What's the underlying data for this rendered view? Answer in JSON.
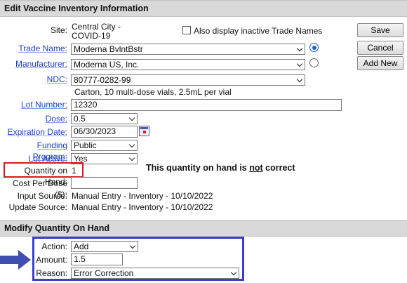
{
  "header": {
    "title": "Edit Vaccine Inventory Information"
  },
  "site": {
    "label": "Site:",
    "line1": "Central City -",
    "line2": "COVID-19"
  },
  "inactive": {
    "label": "Also display inactive Trade Names"
  },
  "buttons": {
    "save": "Save",
    "cancel": "Cancel",
    "add_new": "Add New"
  },
  "fields": {
    "trade_name": {
      "label": "Trade Name:",
      "value": "Moderna BvlntBstr"
    },
    "manufacturer": {
      "label": "Manufacturer:",
      "value": "Moderna US, Inc."
    },
    "ndc": {
      "label": "NDC:",
      "value": "80777-0282-99",
      "description": "Carton, 10 multi-dose vials, 2.5mL per vial"
    },
    "lot_number": {
      "label": "Lot Number:",
      "value": "12320"
    },
    "dose": {
      "label": "Dose:",
      "value": "0.5"
    },
    "expiration_date": {
      "label": "Expiration Date:",
      "value": "06/30/2023"
    },
    "funding_program": {
      "label": "Funding Program:",
      "value": "Public"
    },
    "lot_active": {
      "label": "Lot Active:",
      "value": "Yes"
    },
    "quantity_on_hand": {
      "label": "Quantity on Hand:",
      "value": "1"
    },
    "cost_per_dose": {
      "label": "Cost Per Dose ($):",
      "value": ""
    },
    "input_source": {
      "label": "Input Source:",
      "value": "Manual Entry - Inventory - 10/10/2022"
    },
    "update_source": {
      "label": "Update Source:",
      "value": "Manual Entry - Inventory - 10/10/2022"
    }
  },
  "annotation": {
    "pre": "This quantity on hand is ",
    "emph": "not",
    "post": " correct"
  },
  "modify": {
    "title": "Modify Quantity On Hand",
    "action": {
      "label": "Action:",
      "value": "Add"
    },
    "amount": {
      "label": "Amount:",
      "value": "1.5"
    },
    "reason": {
      "label": "Reason:",
      "value": "Error Correction"
    }
  },
  "colors": {
    "link_blue": "#1a3ccf",
    "highlight_red": "#e0141c",
    "highlight_blue": "#3b3fc8",
    "arrow_blue": "#3e4fb0",
    "header_gray": "#d9d9d9"
  }
}
